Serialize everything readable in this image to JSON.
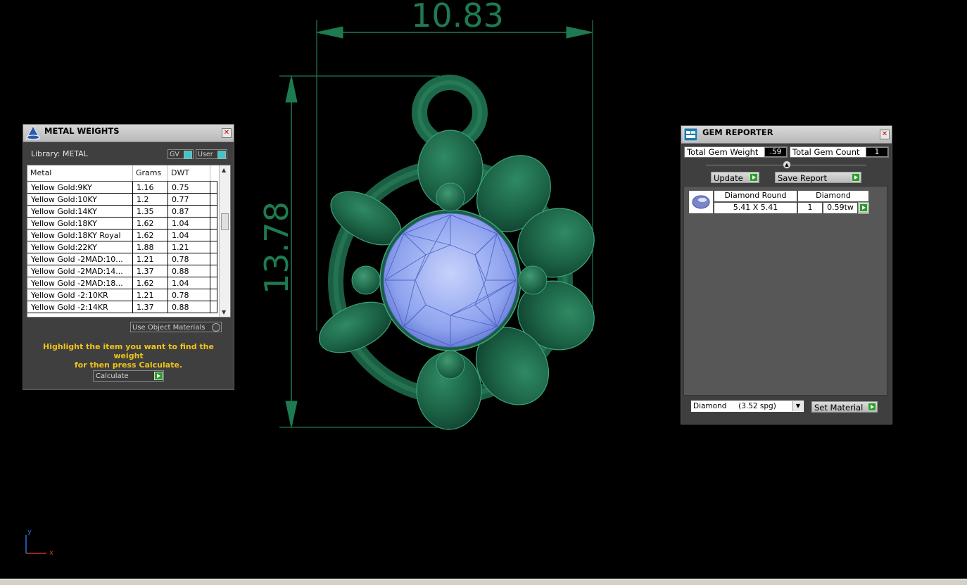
{
  "viewport": {
    "dim_width": "10.83",
    "dim_height": "13.78",
    "axis_y": "y",
    "axis_x": "x"
  },
  "metal_weights": {
    "title": "METAL WEIGHTS",
    "library_label": "Library: METAL",
    "gv_label": "GV",
    "user_label": "User",
    "columns": [
      "Metal",
      "Grams",
      "DWT"
    ],
    "rows": [
      {
        "metal": "Yellow Gold:9KY",
        "grams": "1.16",
        "dwt": "0.75"
      },
      {
        "metal": "Yellow Gold:10KY",
        "grams": "1.2",
        "dwt": "0.77"
      },
      {
        "metal": "Yellow Gold:14KY",
        "grams": "1.35",
        "dwt": "0.87"
      },
      {
        "metal": "Yellow Gold:18KY",
        "grams": "1.62",
        "dwt": "1.04"
      },
      {
        "metal": "Yellow Gold:18KY Royal",
        "grams": "1.62",
        "dwt": "1.04"
      },
      {
        "metal": "Yellow Gold:22KY",
        "grams": "1.88",
        "dwt": "1.21"
      },
      {
        "metal": "Yellow Gold -2MAD:10...",
        "grams": "1.21",
        "dwt": "0.78"
      },
      {
        "metal": "Yellow Gold -2MAD:14...",
        "grams": "1.37",
        "dwt": "0.88"
      },
      {
        "metal": "Yellow Gold -2MAD:18...",
        "grams": "1.62",
        "dwt": "1.04"
      },
      {
        "metal": "Yellow Gold -2:10KR",
        "grams": "1.21",
        "dwt": "0.78"
      },
      {
        "metal": "Yellow Gold -2:14KR",
        "grams": "1.37",
        "dwt": "0.88"
      }
    ],
    "use_object_materials": "Use Object Materials",
    "hint_line1": "Highlight the item you want to find the weight",
    "hint_line2": "for then press Calculate.",
    "calculate_label": "Calculate"
  },
  "gem_reporter": {
    "title": "GEM REPORTER",
    "total_weight_label": "Total Gem Weight",
    "total_weight_value": ".59",
    "total_count_label": "Total Gem Count",
    "total_count_value": "1",
    "update_label": "Update",
    "save_report_label": "Save Report",
    "gem": {
      "shape": "Diamond Round",
      "material": "Diamond",
      "size": "5.41 X 5.41",
      "count": "1",
      "weight": "0.59tw"
    },
    "material_select": "Diamond     (3.52 spg)",
    "set_material_label": "Set Material"
  },
  "colors": {
    "metal_green": "#1f6b4f",
    "dimension_green": "#1e7a50",
    "gem_blue": "#8fa4f0",
    "hint_yellow": "#f0c419"
  }
}
